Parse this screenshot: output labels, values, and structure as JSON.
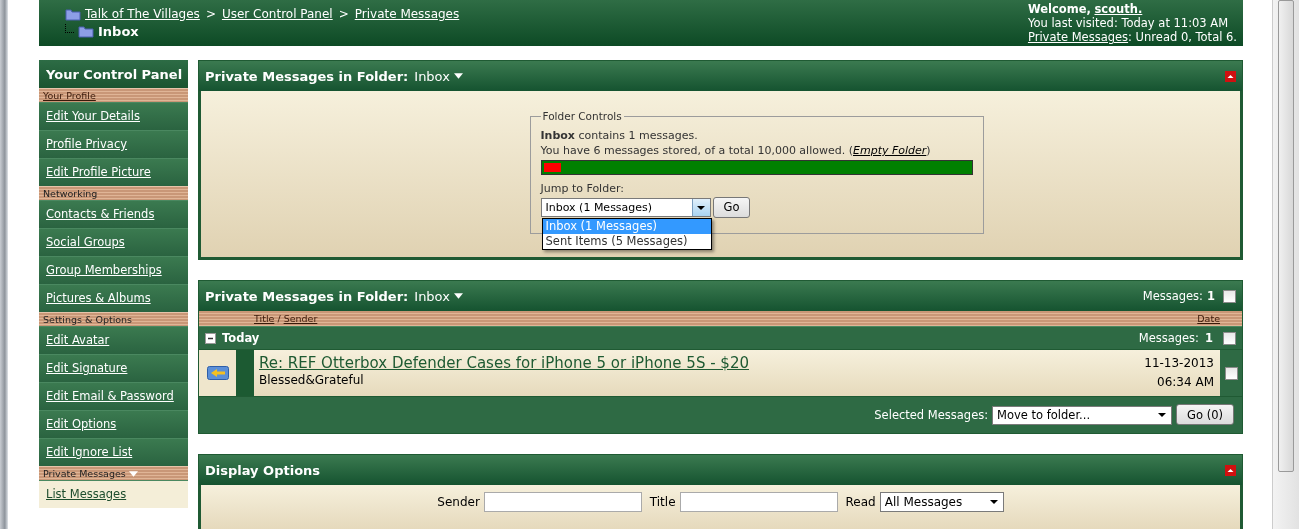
{
  "header": {
    "breadcrumb": [
      "Talk of The Villages",
      "User Control Panel",
      "Private Messages"
    ],
    "separator": ">",
    "current": "Inbox",
    "welcome_label": "Welcome,",
    "username": "scouth.",
    "last_visited": "You last visited: Today at 11:03 AM",
    "pm_link": "Private Messages",
    "pm_summary": ": Unread 0, Total 6."
  },
  "sidebar": {
    "title": "Your Control Panel",
    "sections": [
      {
        "heading": "Your Profile",
        "heading_link": true,
        "menu": false,
        "items": [
          {
            "label": "Edit Your Details",
            "selected": false
          },
          {
            "label": "Profile Privacy",
            "selected": false
          },
          {
            "label": "Edit Profile Picture",
            "selected": false
          }
        ]
      },
      {
        "heading": "Networking",
        "heading_link": false,
        "menu": false,
        "items": [
          {
            "label": "Contacts & Friends",
            "selected": false
          },
          {
            "label": "Social Groups",
            "selected": false
          },
          {
            "label": "Group Memberships",
            "selected": false
          },
          {
            "label": "Pictures & Albums",
            "selected": false
          }
        ]
      },
      {
        "heading": "Settings & Options",
        "heading_link": false,
        "menu": false,
        "items": [
          {
            "label": "Edit Avatar",
            "selected": false
          },
          {
            "label": "Edit Signature",
            "selected": false
          },
          {
            "label": "Edit Email & Password",
            "selected": false
          },
          {
            "label": "Edit Options",
            "selected": false
          },
          {
            "label": "Edit Ignore List",
            "selected": false
          }
        ]
      },
      {
        "heading": "Private Messages",
        "heading_link": false,
        "menu": true,
        "items": [
          {
            "label": "List Messages",
            "selected": true
          }
        ]
      }
    ]
  },
  "folder_panel": {
    "title": "Private Messages in Folder:",
    "folder": "Inbox",
    "legend": "Folder Controls",
    "contains": "**Inbox** contains 1 messages.",
    "stored_prefix": "You have 6 messages stored, of a total 10,000 allowed. (",
    "empty_link": "Empty Folder",
    "stored_suffix": ")",
    "level": 0.04,
    "jump_label": "Jump to Folder:",
    "jump_value": "Inbox (1 Messages)",
    "go": "Go",
    "options": [
      {
        "label": "Inbox (1 Messages)",
        "selected": true
      },
      {
        "label": "Sent Items (5 Messages)",
        "selected": false
      }
    ]
  },
  "messages_panel": {
    "title": "Private Messages in Folder:",
    "folder": "Inbox",
    "count_label": "Messages:",
    "count": "1",
    "checked": false,
    "col_title": "Title",
    "col_slash": "/",
    "col_sender": "Sender",
    "col_date": "Date",
    "groups": [
      {
        "label": "Today",
        "count_label": "Messages:",
        "count": "1",
        "expanded": true,
        "checked": false,
        "messages": [
          {
            "title": "Re: REF Otterbox Defender Cases for iPhone 5 or iPhone 5S - $20",
            "sender": "Blessed&Grateful",
            "date": "11-13-2013",
            "time": "06:34 AM",
            "checked": false
          }
        ]
      }
    ],
    "selected_label": "Selected Messages:",
    "action": "Move to folder...",
    "go": "Go (0)"
  },
  "display_panel": {
    "title": "Display Options",
    "fields": [
      {
        "kind": "text",
        "label": "Sender"
      },
      {
        "kind": "text",
        "label": "Title"
      },
      {
        "kind": "select",
        "label": "Read",
        "value": "All Messages"
      }
    ]
  }
}
